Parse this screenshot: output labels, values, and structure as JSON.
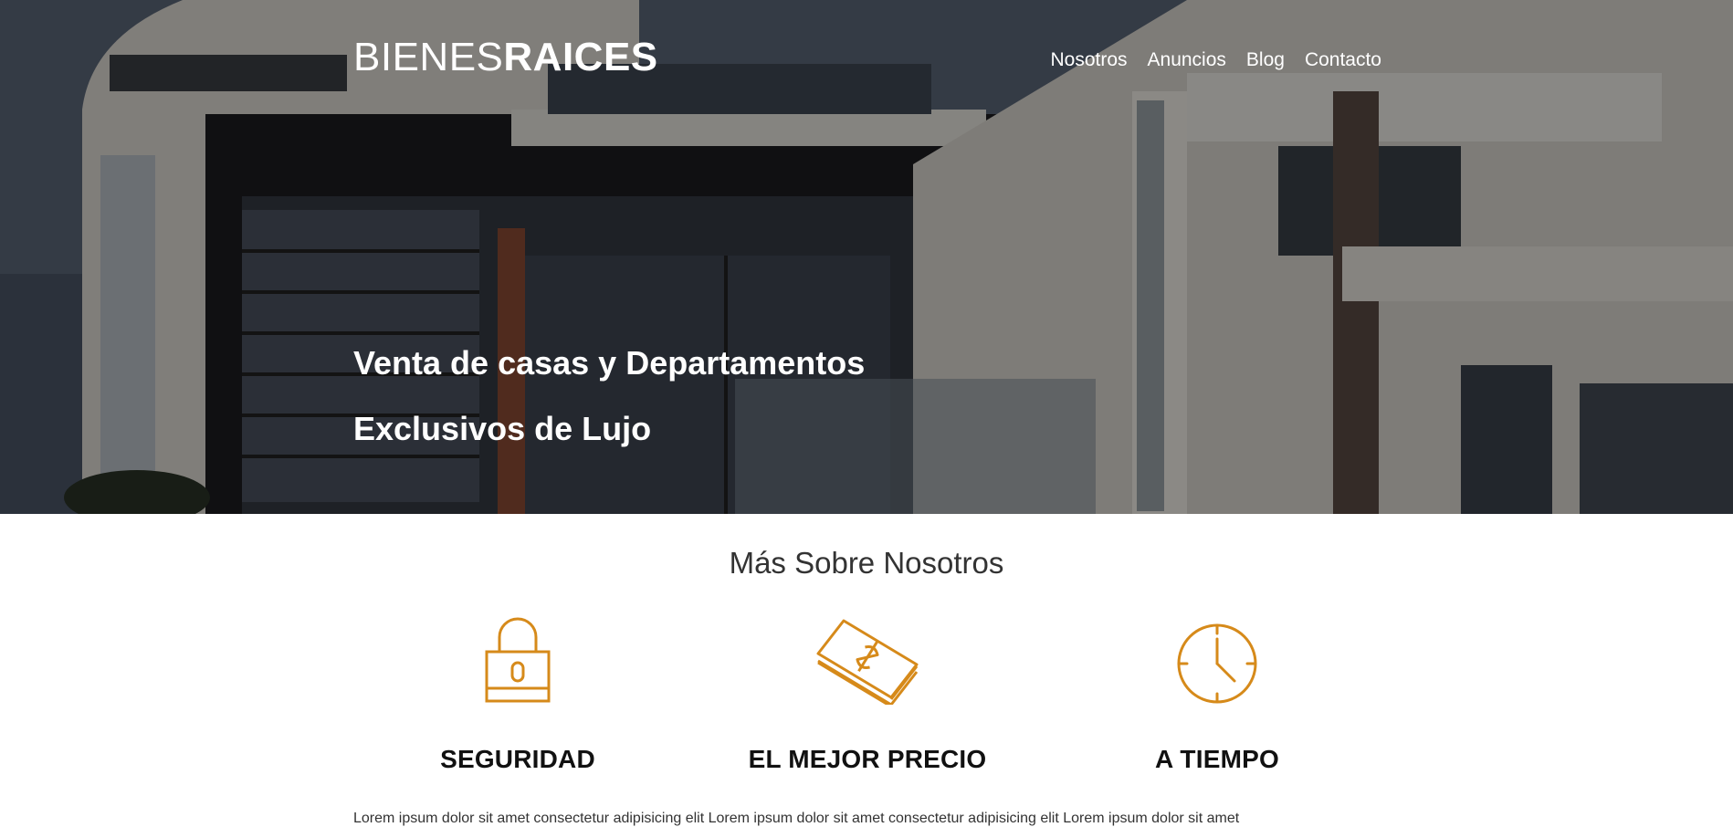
{
  "brand": {
    "logo_thin": "BIENES",
    "logo_bold": "RAICES"
  },
  "nav": {
    "items": [
      "Nosotros",
      "Anuncios",
      "Blog",
      "Contacto"
    ]
  },
  "hero": {
    "line1": "Venta de casas y Departamentos",
    "line2": "Exclusivos de Lujo"
  },
  "about": {
    "title": "Más Sobre Nosotros",
    "features": [
      {
        "title": "SEGURIDAD",
        "icon": "lock-icon"
      },
      {
        "title": "EL MEJOR PRECIO",
        "icon": "money-stack-icon"
      },
      {
        "title": "A TIEMPO",
        "icon": "clock-icon"
      }
    ],
    "body_text": "Lorem ipsum dolor sit amet consectetur adipisicing elit Lorem ipsum dolor sit amet consectetur adipisicing elit Lorem ipsum dolor sit amet"
  },
  "colors": {
    "accent": "#D68A1A",
    "overlay": "rgba(0,0,0,0.42)",
    "text_dark": "#111111"
  }
}
